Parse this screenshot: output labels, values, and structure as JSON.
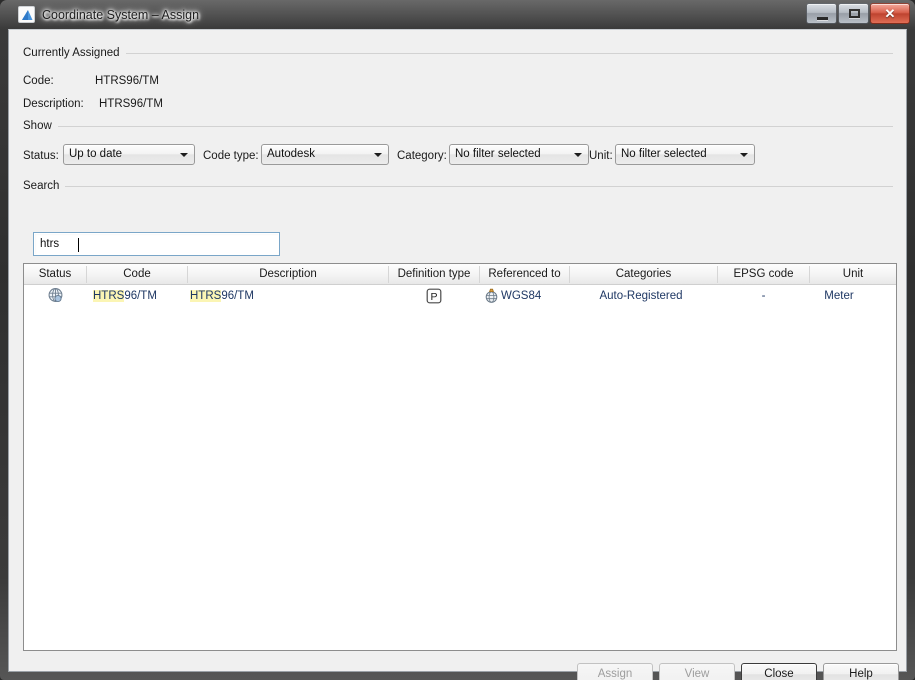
{
  "window": {
    "title": "Coordinate System – Assign",
    "app_icon": "autodesk-icon",
    "controls": {
      "minimize": "–",
      "maximize": "□",
      "close": "✕"
    }
  },
  "currently_assigned": {
    "group_label": "Currently Assigned",
    "code_label": "Code:",
    "code_value": "HTRS96/TM",
    "description_label": "Description:",
    "description_value": "HTRS96/TM"
  },
  "show": {
    "group_label": "Show",
    "status_label": "Status:",
    "status_value": "Up to date",
    "code_type_label": "Code type:",
    "code_type_value": "Autodesk",
    "category_label": "Category:",
    "category_value": "No filter selected",
    "unit_label": "Unit:",
    "unit_value": "No filter selected"
  },
  "search": {
    "group_label": "Search",
    "value": "htrs",
    "placeholder": ""
  },
  "table": {
    "columns": [
      "Status",
      "Code",
      "Description",
      "Definition type",
      "Referenced to",
      "Categories",
      "EPSG code",
      "Unit"
    ],
    "rows": [
      {
        "status_icon": "globe-icon",
        "code_match": "HTRS",
        "code_rest": "96/TM",
        "description_match": "HTRS",
        "description_rest": "96/TM",
        "definition_type_icon": "projected-p-icon",
        "referenced_to_icon": "datum-globe-icon",
        "referenced_to": "WGS84",
        "categories": "Auto-Registered",
        "epsg_code": "-",
        "unit": "Meter"
      }
    ]
  },
  "footer": {
    "assign_label": "Assign",
    "view_label": "View",
    "close_label": "Close",
    "help_label": "Help"
  },
  "colors": {
    "highlight": "#fbf5b4",
    "link_text": "#1f3864",
    "dialog_bg": "#f0f0f0"
  }
}
